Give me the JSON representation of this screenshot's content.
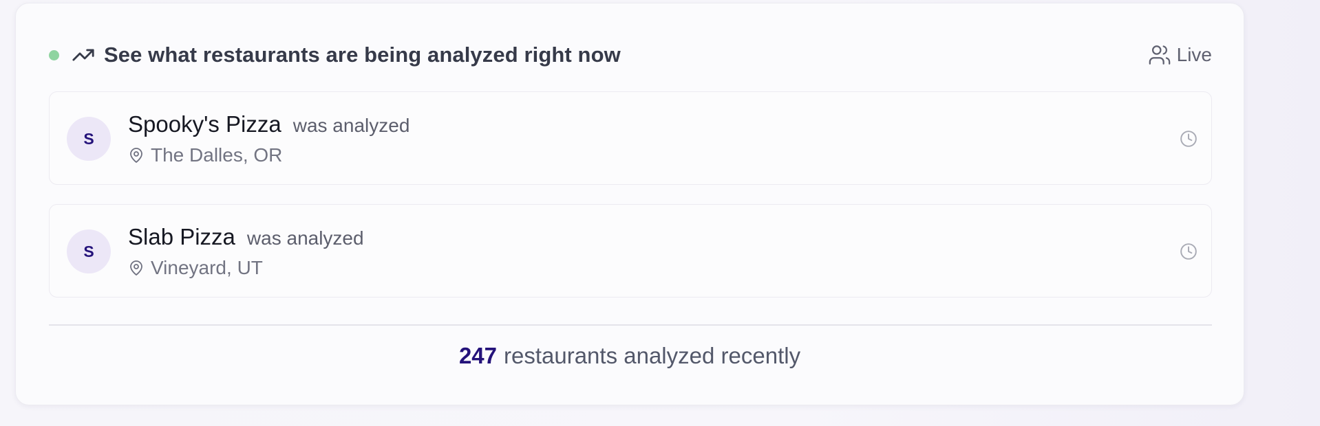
{
  "colors": {
    "live_dot": "#8fd4a0",
    "accent": "#24127a",
    "avatar_bg": "#ece7f7",
    "icon_stroke": "#4b4e5c",
    "muted_icon": "#a9abb5"
  },
  "header": {
    "title": "See what restaurants are being analyzed right now",
    "trend_icon": "trending-up-icon",
    "live_label": "Live",
    "live_icon": "users-icon"
  },
  "activity": [
    {
      "avatar_letter": "S",
      "name": "Spooky's Pizza",
      "action": "was analyzed",
      "location": "The Dalles, OR",
      "location_icon": "map-pin-icon",
      "time_icon": "clock-icon"
    },
    {
      "avatar_letter": "S",
      "name": "Slab Pizza",
      "action": "was analyzed",
      "location": "Vineyard, UT",
      "location_icon": "map-pin-icon",
      "time_icon": "clock-icon"
    }
  ],
  "footer": {
    "count": "247",
    "text": "restaurants analyzed recently"
  }
}
